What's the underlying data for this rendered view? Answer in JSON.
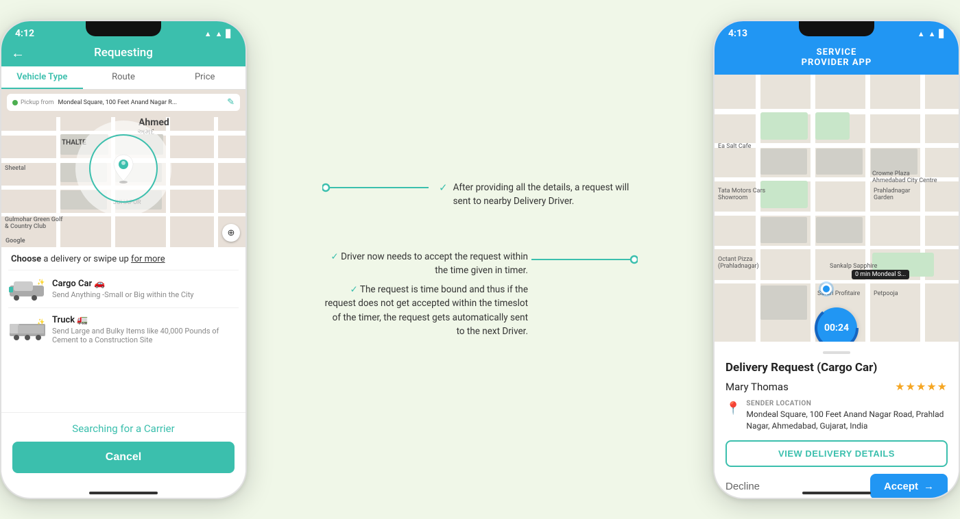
{
  "page": {
    "background": "#f0f7e8"
  },
  "left_phone": {
    "status_bar": {
      "time": "4:12",
      "icons": "▲ ▲ 🔋"
    },
    "header": {
      "back_label": "←",
      "title": "Requesting"
    },
    "tabs": [
      {
        "label": "Vehicle Type",
        "active": true
      },
      {
        "label": "Route",
        "active": false
      },
      {
        "label": "Price",
        "active": false
      }
    ],
    "map": {
      "pickup_label": "Pickup from",
      "pickup_address": "Mondeal Square, 100 Feet Anand Nagar R...",
      "city_label": "Ahmed"
    },
    "choose_text": "Choose a delivery or swipe up for more",
    "vehicles": [
      {
        "name": "Cargo Car 🚗",
        "desc": "Send Anything -Small or Big within the City",
        "icon": "cargo"
      },
      {
        "name": "Truck 🚛",
        "desc": "Send Large and Bulky Items like 40,000 Pounds of Cement to a Construction Site",
        "icon": "truck"
      }
    ],
    "searching_text": "Searching for a Carrier",
    "cancel_label": "Cancel"
  },
  "right_phone": {
    "status_bar": {
      "time": "4:13",
      "icons": "▲ ▲ 🔋"
    },
    "header": {
      "title": "SERVICE\nPROVIDER APP"
    },
    "timer": {
      "value": "00:24"
    },
    "delivery_card": {
      "title": "Delivery Request (Cargo Car)",
      "user_name": "Mary Thomas",
      "stars": "★★★★★",
      "sender_location_label": "SENDER LOCATION",
      "sender_address": "Mondeal Square, 100 Feet Anand Nagar Road, Prahlad Nagar, Ahmedabad, Gujarat, India",
      "view_btn_label": "VIEW DELIVERY DETAILS",
      "decline_label": "Decline",
      "accept_label": "Accept"
    }
  },
  "annotations": [
    {
      "id": "annotation1",
      "text": "After providing all the details, a request will sent to nearby Delivery Driver.",
      "position": "right"
    },
    {
      "id": "annotation2",
      "text1": "Driver now needs to accept the request within the time given in timer.",
      "text2": "The request is time bound and thus if the request does not get accepted within the timeslot of the timer, the request gets automatically sent to the next Driver.",
      "position": "left"
    }
  ]
}
